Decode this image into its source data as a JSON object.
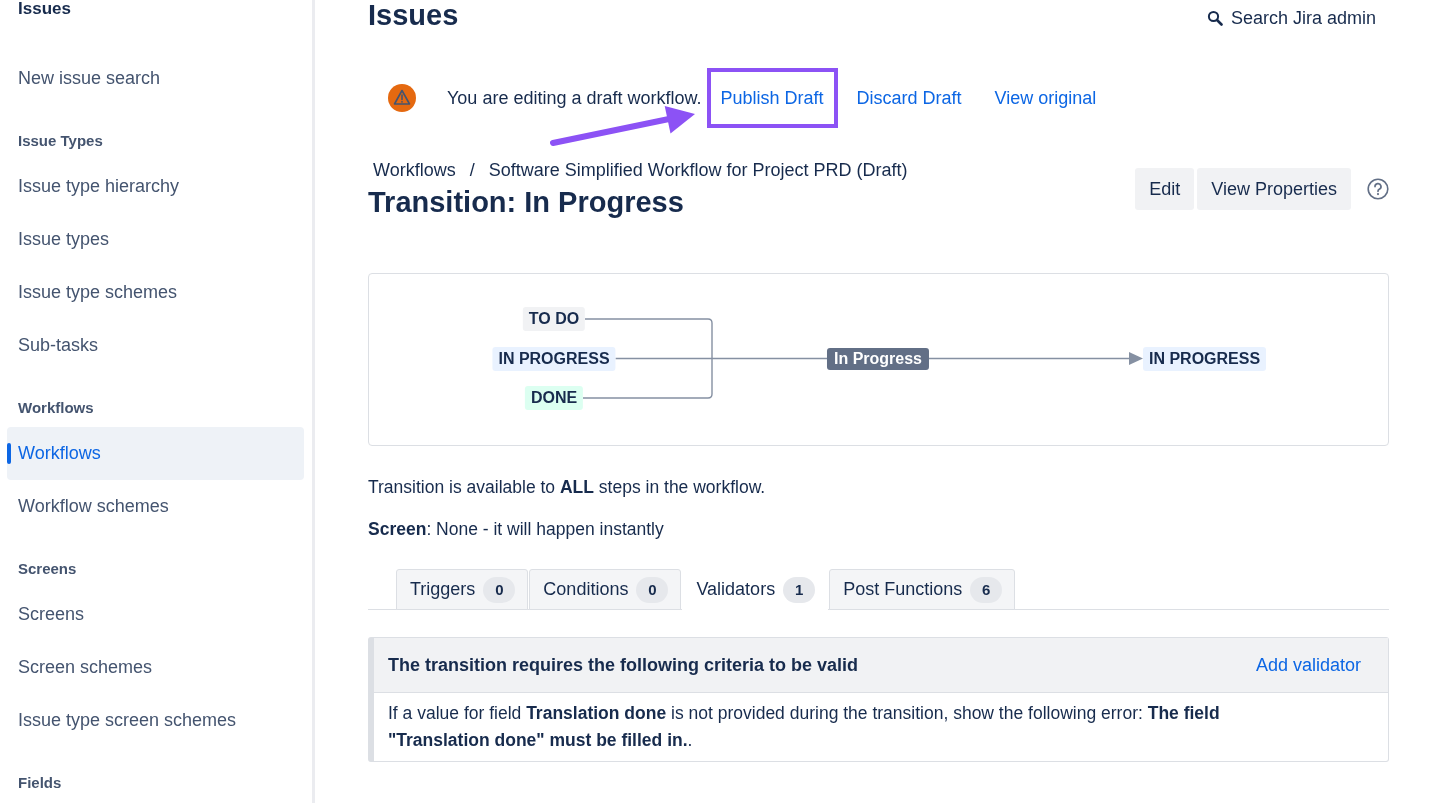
{
  "sidebar": {
    "title": "Issues",
    "sections": [
      {
        "items": [
          {
            "label": "New issue search",
            "selected": false
          }
        ]
      },
      {
        "heading": "Issue Types",
        "items": [
          {
            "label": "Issue type hierarchy",
            "selected": false
          },
          {
            "label": "Issue types",
            "selected": false
          },
          {
            "label": "Issue type schemes",
            "selected": false
          },
          {
            "label": "Sub-tasks",
            "selected": false
          }
        ]
      },
      {
        "heading": "Workflows",
        "items": [
          {
            "label": "Workflows",
            "selected": true
          },
          {
            "label": "Workflow schemes",
            "selected": false
          }
        ]
      },
      {
        "heading": "Screens",
        "items": [
          {
            "label": "Screens",
            "selected": false
          },
          {
            "label": "Screen schemes",
            "selected": false
          },
          {
            "label": "Issue type screen schemes",
            "selected": false
          }
        ]
      },
      {
        "heading": "Fields"
      }
    ]
  },
  "header": {
    "title": "Issues",
    "search": {
      "label": "Search Jira admin"
    }
  },
  "draft_banner": {
    "message": "You are editing a draft workflow.",
    "links": [
      {
        "label": "Publish Draft",
        "highlighted": true
      },
      {
        "label": "Discard Draft",
        "highlighted": false
      },
      {
        "label": "View original",
        "highlighted": false
      }
    ]
  },
  "breadcrumbs": {
    "items": [
      "Workflows",
      "Software Simplified Workflow for Project PRD (Draft)"
    ],
    "separator": "/"
  },
  "page_title": "Transition: In Progress",
  "actions": [
    {
      "label": "Edit"
    },
    {
      "label": "View Properties"
    }
  ],
  "diagram": {
    "from_statuses": [
      {
        "label": "TO DO",
        "kind": "todo"
      },
      {
        "label": "IN PROGRESS",
        "kind": "progress"
      },
      {
        "label": "DONE",
        "kind": "done"
      }
    ],
    "transition": {
      "label": "In Progress"
    },
    "to_status": {
      "label": "IN PROGRESS",
      "kind": "progress"
    }
  },
  "availability": "Transition is available to **ALL** steps in the workflow.",
  "screen_info": "**Screen**: None - it will happen instantly",
  "tabs": [
    {
      "label": "Triggers",
      "count": "0",
      "selected": false
    },
    {
      "label": "Conditions",
      "count": "0",
      "selected": false
    },
    {
      "label": "Validators",
      "count": "1",
      "selected": true
    },
    {
      "label": "Post Functions",
      "count": "6",
      "selected": false
    }
  ],
  "validators_panel": {
    "heading": "The transition requires the following criteria to be valid",
    "action": "Add validator",
    "rows": [
      "If a value for field **Translation done** is not provided during the transition, show the following error: **The field \"Translation done\" must be filled in.**."
    ]
  }
}
